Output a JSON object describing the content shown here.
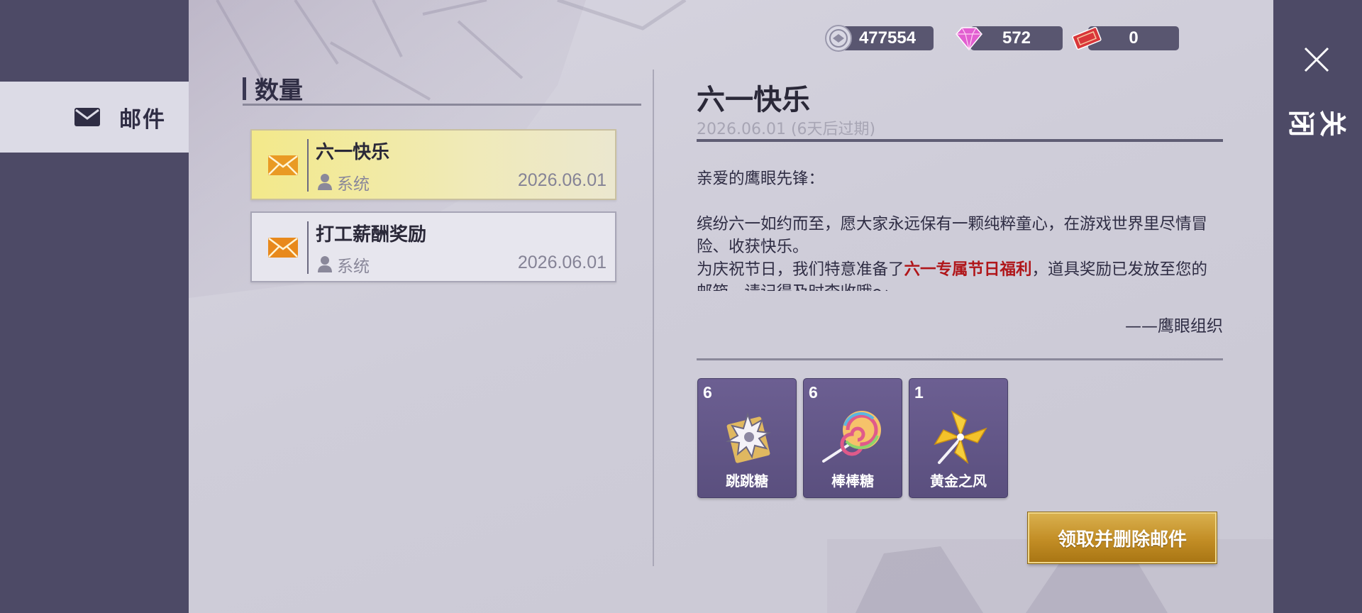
{
  "sidebar": {
    "tab_mail_label": "邮件"
  },
  "close": {
    "label": "关闭"
  },
  "currencies": [
    {
      "icon": "coin-icon",
      "value": "477554"
    },
    {
      "icon": "diamond-icon",
      "value": "572"
    },
    {
      "icon": "ticket-icon",
      "value": "0"
    }
  ],
  "mail_list": {
    "header": "数量",
    "items": [
      {
        "title": "六一快乐",
        "sender": "系统",
        "date": "2026.06.01",
        "selected": true
      },
      {
        "title": "打工薪酬奖励",
        "sender": "系统",
        "date": "2026.06.01",
        "selected": false
      }
    ]
  },
  "detail": {
    "title": "六一快乐",
    "date_line": "2026.06.01 (6天后过期)",
    "greeting": "亲爱的鹰眼先锋：",
    "para1": "缤纷六一如约而至，愿大家永远保有一颗纯粹童心，在游戏世界里尽情冒险、收获快乐。",
    "para2_pre": "为庆祝节日，我们特意准备了",
    "para2_highlight": "六一专属节日福利",
    "para2_post": "，道具奖励已发放至您的邮箱，请记得及时查收哦～",
    "signature": "——鹰眼组织",
    "highlight_color": "#b0161a"
  },
  "rewards": [
    {
      "count": "6",
      "name": "跳跳糖",
      "icon": "popping-candy-icon"
    },
    {
      "count": "6",
      "name": "棒棒糖",
      "icon": "lollipop-icon"
    },
    {
      "count": "1",
      "name": "黄金之风",
      "icon": "golden-pinwheel-icon"
    }
  ],
  "actions": {
    "claim_delete_label": "领取并删除邮件"
  }
}
